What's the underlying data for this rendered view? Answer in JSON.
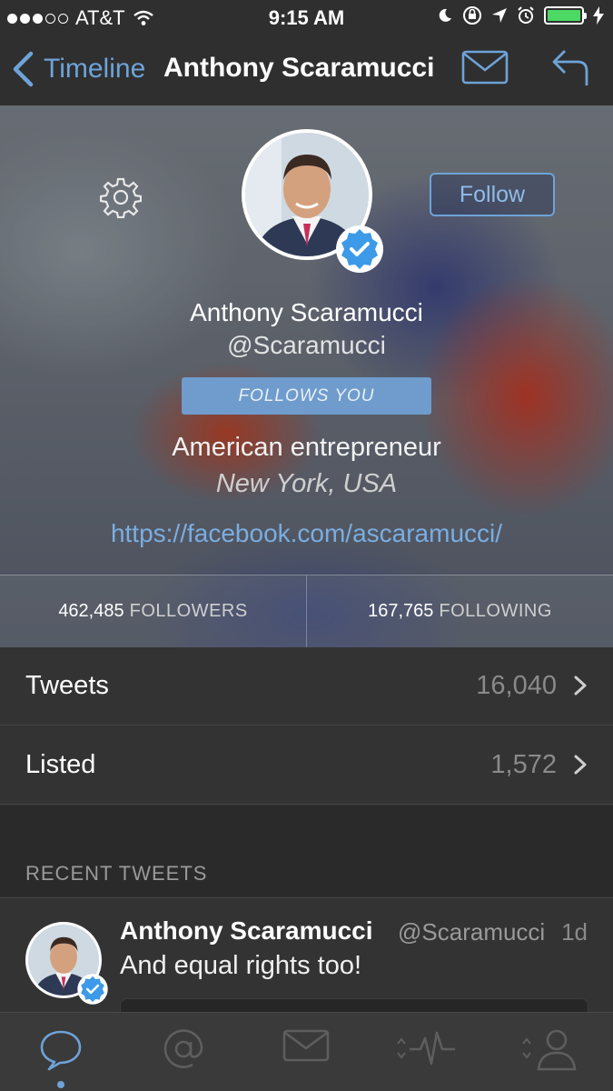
{
  "status_bar": {
    "carrier": "AT&T",
    "time": "9:15 AM",
    "battery_color": "#4cd964"
  },
  "nav": {
    "back_label": "Timeline",
    "title": "Anthony Scaramucci",
    "icons": [
      "chevron-left-icon",
      "envelope-icon",
      "reply-icon"
    ]
  },
  "profile": {
    "name": "Anthony Scaramucci",
    "handle": "@Scaramucci",
    "follow_label": "Follow",
    "follows_you": "FOLLOWS YOU",
    "bio": "American entrepreneur",
    "location": "New York, USA",
    "website": "https://facebook.com/ascaramucci/",
    "verified": true,
    "stats": {
      "followers_count": "462,485",
      "followers_label": "FOLLOWERS",
      "following_count": "167,765",
      "following_label": "FOLLOWING"
    }
  },
  "rows": [
    {
      "label": "Tweets",
      "value": "16,040"
    },
    {
      "label": "Listed",
      "value": "1,572"
    }
  ],
  "recent": {
    "section_title": "RECENT TWEETS",
    "tweet": {
      "author": "Anthony Scaramucci",
      "handle": "@Scaramucci",
      "time": "1d",
      "text": "And equal rights too!"
    }
  },
  "tab_bar": {
    "tabs": [
      "timeline-bubble-icon",
      "mentions-at-icon",
      "messages-envelope-icon",
      "activity-pulse-icon",
      "profile-person-icon"
    ],
    "active_index": 0
  },
  "colors": {
    "accent": "#6ea3d8",
    "background": "#2f2f2f",
    "verified": "#3d9ae8"
  }
}
